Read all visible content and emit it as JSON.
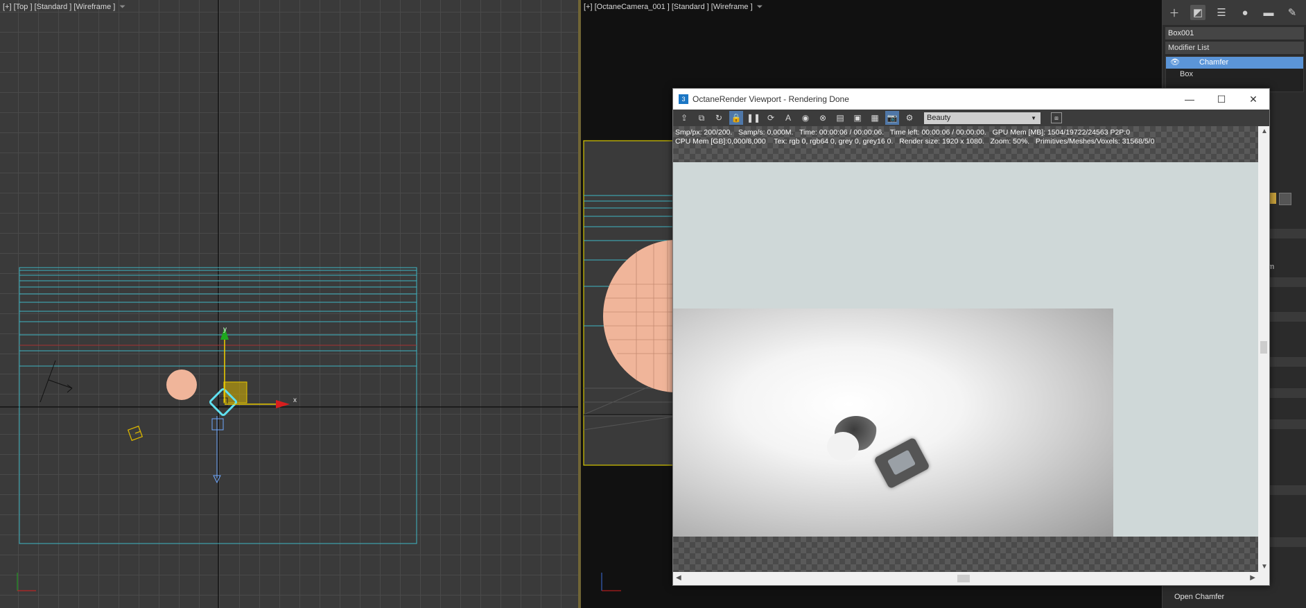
{
  "top_viewport": {
    "label": "[+] [Top ] [Standard ] [Wireframe ]",
    "axis_x": "x",
    "axis_y": "y"
  },
  "camera_viewport": {
    "label": "[+] [OctaneCamera_001 ] [Standard ] [Wireframe ]"
  },
  "command_panel": {
    "object_name": "Box001",
    "modifier_list": "Modifier List",
    "stack": [
      "Chamfer",
      "Box"
    ],
    "selected_modifier": "Chamfer",
    "bottom_label": "Open Chamfer",
    "partial_text": "m"
  },
  "octane": {
    "title": "OctaneRender Viewport - Rendering Done",
    "app_icon": "3",
    "pass_select": "Beauty",
    "stats_line1": "Smp/px: 200/200.   Samp/s: 0,000M.   Time: 00:00:06 / 00:00:06.   Time left: 00:00:06 / 00:00:00.   GPU Mem [MB]: 1504/19722/24563 P2P:0",
    "stats_line2": "CPU Mem [GB]:0,000/8,000    Tex: rgb 0, rgb64 0, grey 0, grey16 0.   Render size: 1920 x 1080.   Zoom: 50%.   Primitives/Meshes/Voxels: 31568/5/0"
  },
  "colors": {
    "accent": "#5b95d8",
    "wire": "#3fb5c4",
    "selection": "#5fe0f0",
    "axis_x": "#d81e1e",
    "axis_y": "#1ea81e",
    "sphere": "#f0b59a"
  }
}
